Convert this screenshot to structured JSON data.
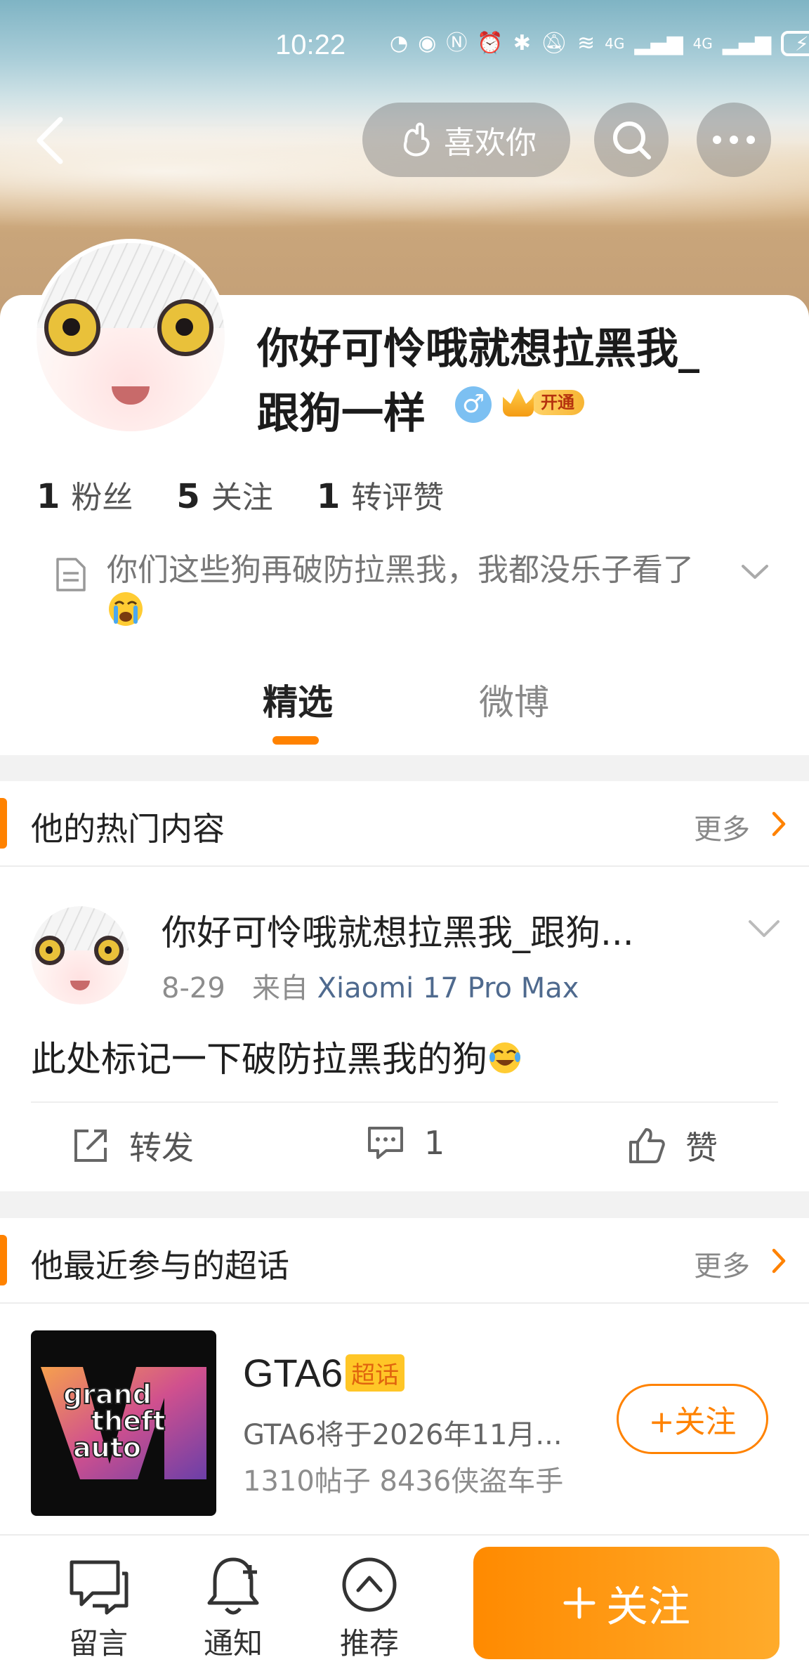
{
  "status_bar": {
    "time": "10:22",
    "network_1": "4G",
    "network_2": "4G"
  },
  "header": {
    "like_label": "喜欢你"
  },
  "profile": {
    "name_line1": "你好可怜哦就想拉黑我_",
    "name_line2": "跟狗一样",
    "gender_symbol": "♂",
    "vip_label": "开通",
    "stats": [
      {
        "num": "1",
        "label": "粉丝"
      },
      {
        "num": "5",
        "label": "关注"
      },
      {
        "num": "1",
        "label": "转评赞"
      }
    ],
    "bio": "你们这些狗再破防拉黑我，我都没乐子看了"
  },
  "tabs": {
    "featured": "精选",
    "weibo": "微博"
  },
  "hot_section": {
    "title": "他的热门内容",
    "more": "更多"
  },
  "post": {
    "author": "你好可怜哦就想拉黑我_跟狗...",
    "date": "8-29",
    "source_prefix": "来自",
    "device": "Xiaomi 17 Pro Max",
    "text": "此处标记一下破防拉黑我的狗",
    "repost_label": "转发",
    "comment_count": "1",
    "like_label": "赞"
  },
  "topic_section": {
    "title": "他最近参与的超话",
    "more": "更多",
    "topic": {
      "name": "GTA6",
      "tag": "超话",
      "desc": "GTA6将于2026年11月...",
      "stats": "1310帖子 8436侠盗车手",
      "follow_label": "+关注",
      "cover_text": [
        "grand",
        "theft",
        "auto"
      ]
    }
  },
  "bottom_bar": {
    "message": "留言",
    "notify": "通知",
    "recommend": "推荐",
    "follow": "关注"
  },
  "colors": {
    "accent": "#ff8200",
    "link": "#4f6a8e"
  }
}
